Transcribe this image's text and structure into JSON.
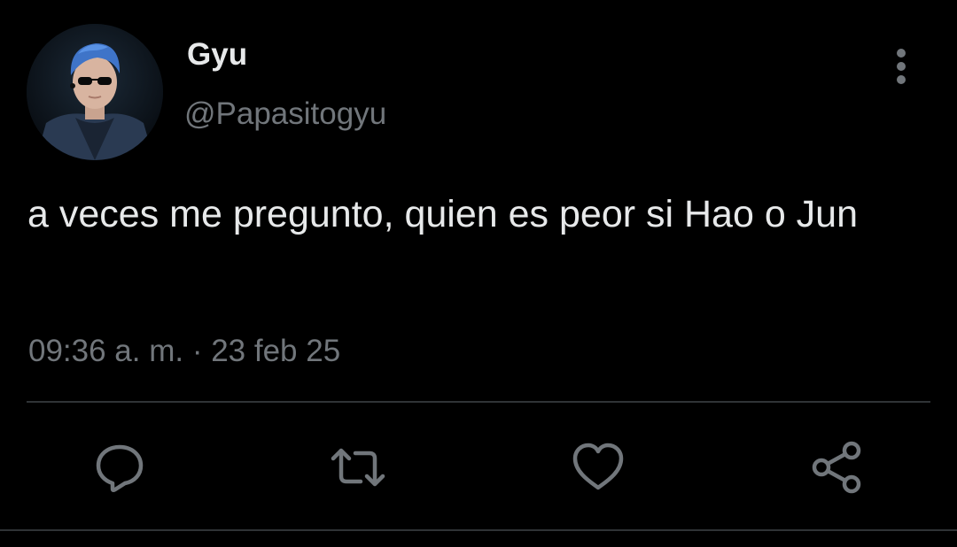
{
  "author": {
    "display_name": "Gyu",
    "handle": "@Papasitogyu"
  },
  "tweet": {
    "text": "a veces me pregunto, quien es peor si Hao o Jun",
    "timestamp": "09:36 a. m. · 23 feb 25"
  },
  "actions": {
    "reply_icon": "speech-bubble",
    "retweet_icon": "retweet-arrows",
    "like_icon": "heart",
    "share_icon": "share-nodes"
  },
  "menu": {
    "more_icon": "vertical-ellipsis"
  },
  "colors": {
    "background": "#000000",
    "primary_text": "#e7e9ea",
    "secondary_text": "#71767b",
    "divider": "#2f3336",
    "icon": "#71767b"
  }
}
